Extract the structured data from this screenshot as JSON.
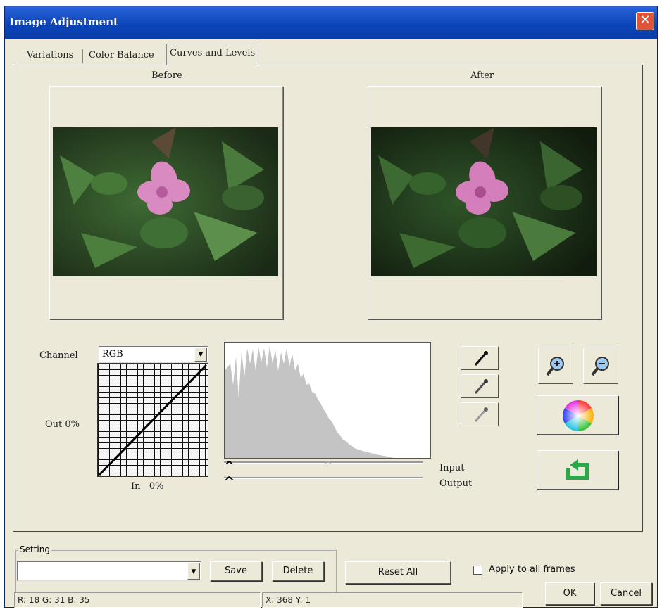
{
  "window": {
    "title": "Image Adjustment",
    "close_glyph": "✕"
  },
  "tabs": [
    {
      "label": "Variations"
    },
    {
      "label": "Color Balance"
    },
    {
      "label": "Curves and Levels"
    }
  ],
  "active_tab": "Curves and Levels",
  "preview": {
    "before_label": "Before",
    "after_label": "After"
  },
  "curves": {
    "channel_label": "Channel",
    "channel_value": "RGB",
    "out_label": "Out 0%",
    "in_label": "In   0%"
  },
  "levels": {
    "input_label": "Input",
    "output_label": "Output",
    "slider_glyph": "^"
  },
  "icons": {
    "black_point": "eyedropper-black-icon",
    "gray_point": "eyedropper-gray-icon",
    "white_point": "eyedropper-white-icon",
    "zoom_in": "zoom-in-icon",
    "zoom_out": "zoom-out-icon",
    "color_wheel": "color-wheel-icon",
    "reset_curve": "undo-arrow-icon"
  },
  "setting": {
    "group_label": "Setting",
    "value": "",
    "save_label": "Save",
    "delete_label": "Delete"
  },
  "reset_all_label": "Reset All",
  "apply_all": {
    "label": "Apply to all frames",
    "checked": false
  },
  "ok_label": "OK",
  "cancel_label": "Cancel",
  "status": {
    "rgb": "R: 18 G: 31 B: 35",
    "xy": "X: 368   Y: 1"
  },
  "colors": {
    "titlebar": "#0b44b8",
    "dialog": "#ece9d8",
    "histogram": "#c4c4c4"
  }
}
